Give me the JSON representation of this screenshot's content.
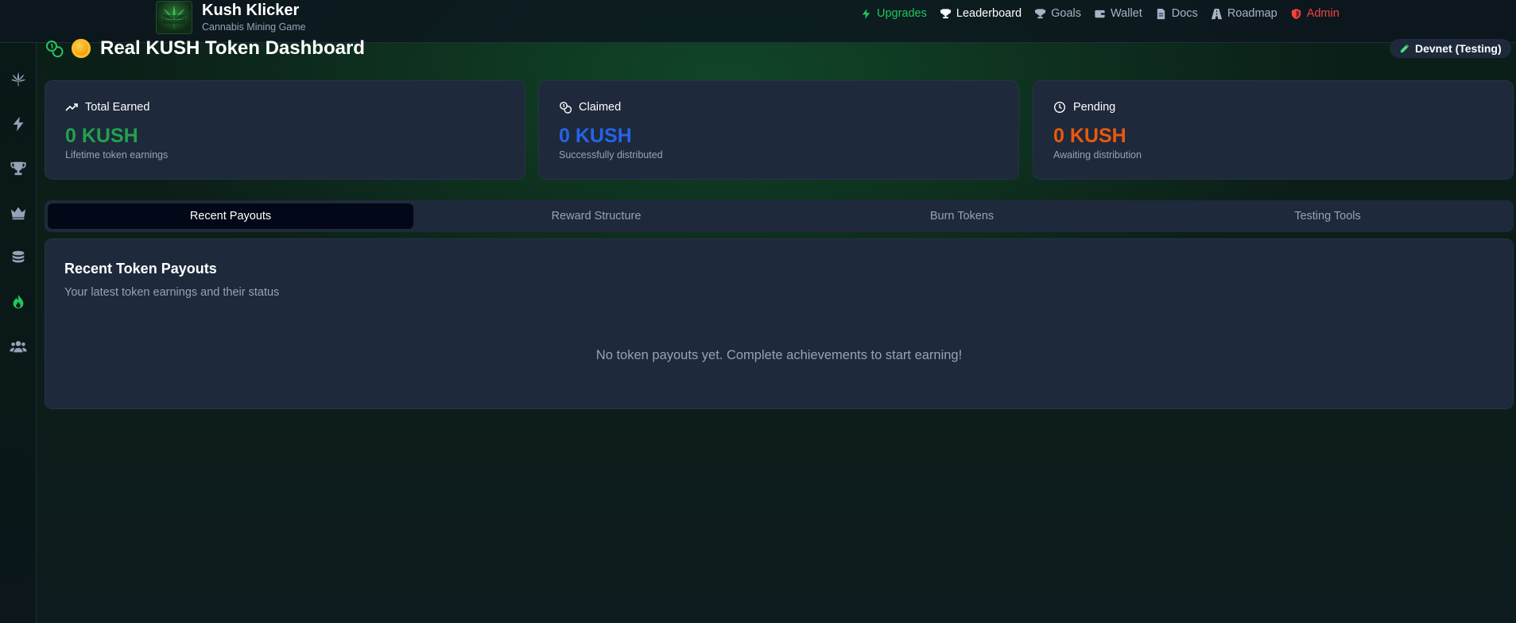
{
  "header": {
    "app_title": "Kush Klicker",
    "app_subtitle": "Cannabis Mining Game",
    "logo_text": "KUSH KLICKER",
    "nav": [
      {
        "label": "Upgrades",
        "icon": "bolt-icon",
        "color": "#22c55e"
      },
      {
        "label": "Leaderboard",
        "icon": "trophy-icon",
        "color": "#ffffff"
      },
      {
        "label": "Goals",
        "icon": "trophy-icon",
        "color": "#a5b4c6"
      },
      {
        "label": "Wallet",
        "icon": "wallet-icon",
        "color": "#a5b4c6"
      },
      {
        "label": "Docs",
        "icon": "document-icon",
        "color": "#a5b4c6"
      },
      {
        "label": "Roadmap",
        "icon": "road-icon",
        "color": "#a5b4c6"
      },
      {
        "label": "Admin",
        "icon": "shield-icon",
        "color": "#ef4444"
      }
    ]
  },
  "sidebar": {
    "items": [
      {
        "icon": "cannabis-leaf-icon"
      },
      {
        "icon": "bolt-icon"
      },
      {
        "icon": "trophy-icon"
      },
      {
        "icon": "crown-icon"
      },
      {
        "icon": "coins-icon"
      },
      {
        "icon": "flame-icon",
        "active": true,
        "color": "#22c55e"
      },
      {
        "icon": "users-icon"
      }
    ]
  },
  "page": {
    "title": "Real KUSH Token Dashboard",
    "network_badge": "Devnet (Testing)"
  },
  "stats": [
    {
      "label": "Total Earned",
      "icon": "trending-up-icon",
      "value": "0 KUSH",
      "description": "Lifetime token earnings",
      "color": "#22a04e"
    },
    {
      "label": "Claimed",
      "icon": "coins-icon",
      "value": "0 KUSH",
      "description": "Successfully distributed",
      "color": "#2563eb"
    },
    {
      "label": "Pending",
      "icon": "clock-icon",
      "value": "0 KUSH",
      "description": "Awaiting distribution",
      "color": "#ea580c"
    }
  ],
  "tabs": [
    {
      "label": "Recent Payouts",
      "active": true
    },
    {
      "label": "Reward Structure",
      "active": false
    },
    {
      "label": "Burn Tokens",
      "active": false
    },
    {
      "label": "Testing Tools",
      "active": false
    }
  ],
  "panel": {
    "title": "Recent Token Payouts",
    "subtitle": "Your latest token earnings and their status",
    "empty_message": "No token payouts yet. Complete achievements to start earning!"
  }
}
